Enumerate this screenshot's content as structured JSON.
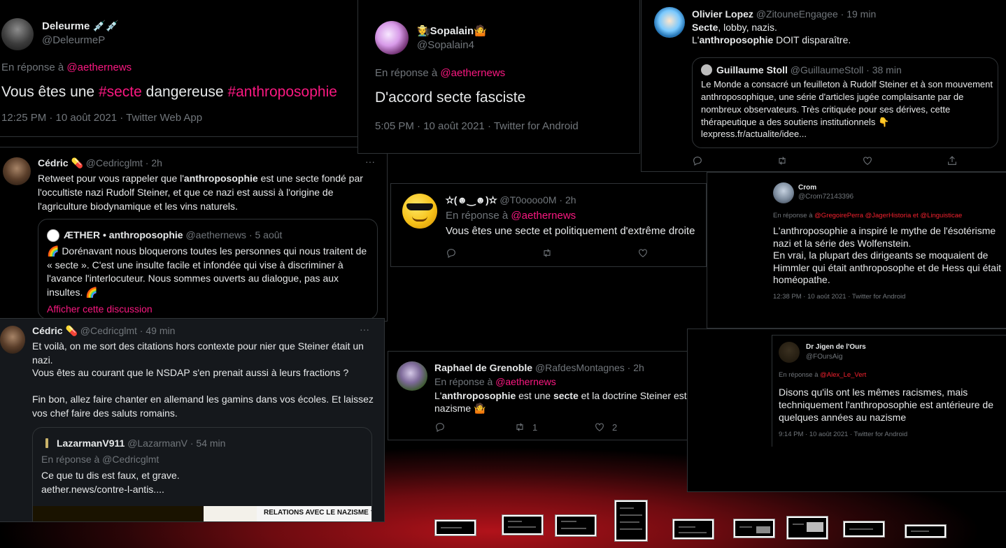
{
  "tweets": {
    "deleurme": {
      "name": "Deleurme 💉💉",
      "handle": "@DeleurmeP",
      "reply_prefix": "En réponse à",
      "reply_to": "@aethernews",
      "text_a": "Vous êtes une",
      "tag1": "#secte",
      "text_b": "dangereuse",
      "tag2": "#anthroposophie",
      "meta": "12:25 PM · 10 août 2021 · Twitter Web App"
    },
    "sopalain": {
      "name": "🧑‍🌾Sopalain🤷",
      "handle": "@Sopalain4",
      "reply_prefix": "En réponse à",
      "reply_to": "@aethernews",
      "text": "D'accord secte fasciste",
      "meta": "5:05 PM · 10 août 2021 · Twitter for Android"
    },
    "olivier": {
      "name": "Olivier Lopez",
      "handle": "@ZitouneEngagee · 19 min",
      "line1_bold": "Secte",
      "line1_rest": ", lobby, nazis.",
      "line2_a": "L'",
      "line2_bold": "anthroposophie",
      "line2_b": " DOIT disparaître.",
      "quote_name": "Guillaume Stoll",
      "quote_handle": "@GuillaumeStoll · 38 min",
      "quote_text": "Le Monde a consacré un feuilleton à Rudolf Steiner et à son mouvement anthroposophique, une série d'articles jugée complaisante par de nombreux observateurs. Très critiquée pour ses dérives, cette thérapeutique a des soutiens institutionnels 👇",
      "quote_link": "lexpress.fr/actualite/idee..."
    },
    "cedric1": {
      "name": "Cédric 💊",
      "handle": "@Cedricglmt · 2h",
      "text_a": "Retweet pour vous rappeler que l'",
      "text_bold": "anthroposophie",
      "text_b": " est une secte fondé par l'occultiste nazi Rudolf Steiner, et que ce nazi est aussi à l'origine de l'agriculture biodynamique et les vins naturels.",
      "more": "···",
      "quote_name": "ÆTHER • anthroposophie",
      "quote_handle": "@aethernews · 5 août",
      "quote_text": "🌈 Dorénavant nous bloquerons toutes les personnes qui nous traitent de « secte ». C'est une insulte facile et infondée qui vise à discriminer à l'avance l'interlocuteur. Nous sommes ouverts au dialogue, pas aux insultes. 🌈",
      "quote_link": "Afficher cette discussion"
    },
    "cedric2": {
      "name": "Cédric 💊",
      "handle": "@Cedricglmt · 49 min",
      "more": "···",
      "para1": "Et voilà, on me sort des citations hors contexte pour nier que Steiner était un nazi.",
      "para2": "Vous êtes au courant que le NSDAP s'en prenait aussi à leurs fractions ?",
      "para3": "Fin bon, allez faire chanter en allemand les gamins dans vos écoles. Et laissez vos chef faire des saluts romains.",
      "quote_name": "LazarmanV911",
      "quote_handle": "@LazarmanV · 54 min",
      "quote_reply": "En réponse à @Cedricglmt",
      "quote_text1": "Ce que tu dis est faux, et grave.",
      "quote_text2": "aether.news/contre-l-antis....",
      "image_caption": "RELATIONS AVEC LE NAZISME ?"
    },
    "toooo": {
      "name": "✫(☻‿☻)✫",
      "handle": "@T0oooo0M · 2h",
      "reply_prefix": "En réponse à",
      "reply_to": "@aethernews",
      "text": "Vous êtes une secte et politiquement d'extrême droite"
    },
    "crom": {
      "name": "Crom",
      "handle": "@Crom72143396",
      "reply_prefix": "En réponse à",
      "reply_to": "@GregoirePerra @JagerHistoria  et  @Linguisticae",
      "text1": "L'anthroposophie a inspiré le mythe de l'ésotérisme nazi et la série des Wolfenstein.",
      "text2": "En vrai, la plupart des dirigeants se moquaient de Himmler qui était anthroposophe et de Hess qui était homéopathe.",
      "meta": "12:38 PM · 10 août 2021 · Twitter for Android"
    },
    "raphael": {
      "name": "Raphael de Grenoble",
      "handle": "@RafdesMontagnes · 2h",
      "reply_prefix": "En réponse à",
      "reply_to": "@aethernews",
      "text_a": "L'",
      "text_bold1": "anthroposophie",
      "text_b": " est une ",
      "text_bold2": "secte",
      "text_c": " et la doctrine Steiner est nazisme 🤷",
      "retweets": "1",
      "likes": "2"
    },
    "jigen": {
      "name": "Dr Jigen de l'Ours",
      "handle": "@FOursAig",
      "reply_prefix": "En réponse à",
      "reply_to": "@Alex_Le_Vert",
      "text": "Disons qu'ils ont les mêmes racismes, mais techniquement l'anthroposophie est antérieure de quelques années au nazisme",
      "meta": "9:14 PM · 10 août 2021 · Twitter for Android"
    }
  },
  "colors": {
    "accent": "#f91880",
    "background": "#000000",
    "text": "#e7e9ea",
    "muted": "#71767b"
  }
}
